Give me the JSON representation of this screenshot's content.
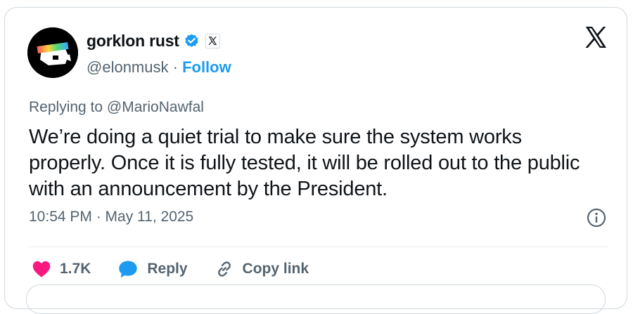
{
  "author": {
    "display_name": "gorklon rust",
    "handle": "@elonmusk",
    "separator": " · ",
    "follow_label": "Follow",
    "verified_color": "#1d9bf0",
    "affiliation_icon": "x-logo-icon",
    "avatar_icon": "pixel-dog-sunglasses-avatar"
  },
  "tweet": {
    "replying_to": "Replying to @MarioNawfal",
    "text": "We’re doing a quiet trial to make sure the system works properly. Once it is fully tested, it will be rolled out to the public with an announcement by the President.",
    "timestamp": "10:54 PM · May 11, 2025"
  },
  "actions": {
    "like_count": "1.7K",
    "like_color": "#f91880",
    "reply_label": "Reply",
    "reply_color": "#1d9bf0",
    "copy_label": "Copy link"
  },
  "icons": {
    "close": "x-logo-icon",
    "info": "info-icon",
    "like": "heart-icon",
    "reply": "speech-bubble-icon",
    "copy": "link-icon"
  }
}
